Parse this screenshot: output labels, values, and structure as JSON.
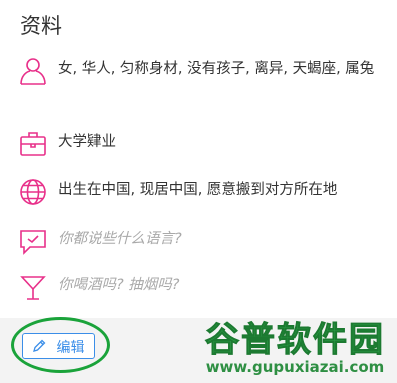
{
  "section_title": "资料",
  "items": [
    {
      "icon": "person-icon",
      "text": "女, 华人, 匀称身材, 没有孩子, 离异, 天蝎座, 属兔",
      "placeholder": false
    },
    {
      "icon": "briefcase-icon",
      "text": "大学肄业",
      "placeholder": false
    },
    {
      "icon": "globe-icon",
      "text": "出生在中国, 现居中国, 愿意搬到对方所在地",
      "placeholder": false
    },
    {
      "icon": "chat-icon",
      "text": "你都说些什么语言?",
      "placeholder": true
    },
    {
      "icon": "cocktail-icon",
      "text": "你喝酒吗? 抽烟吗?",
      "placeholder": true
    }
  ],
  "edit_button": {
    "label": "编辑",
    "icon": "pencil-icon"
  },
  "watermark": {
    "main": "谷普软件园",
    "url": "www.gupuxiazai.com"
  },
  "colors": {
    "accent_pink": "#e8308a",
    "button_blue": "#3b8ee8",
    "annotation_green": "#1aa33a"
  }
}
